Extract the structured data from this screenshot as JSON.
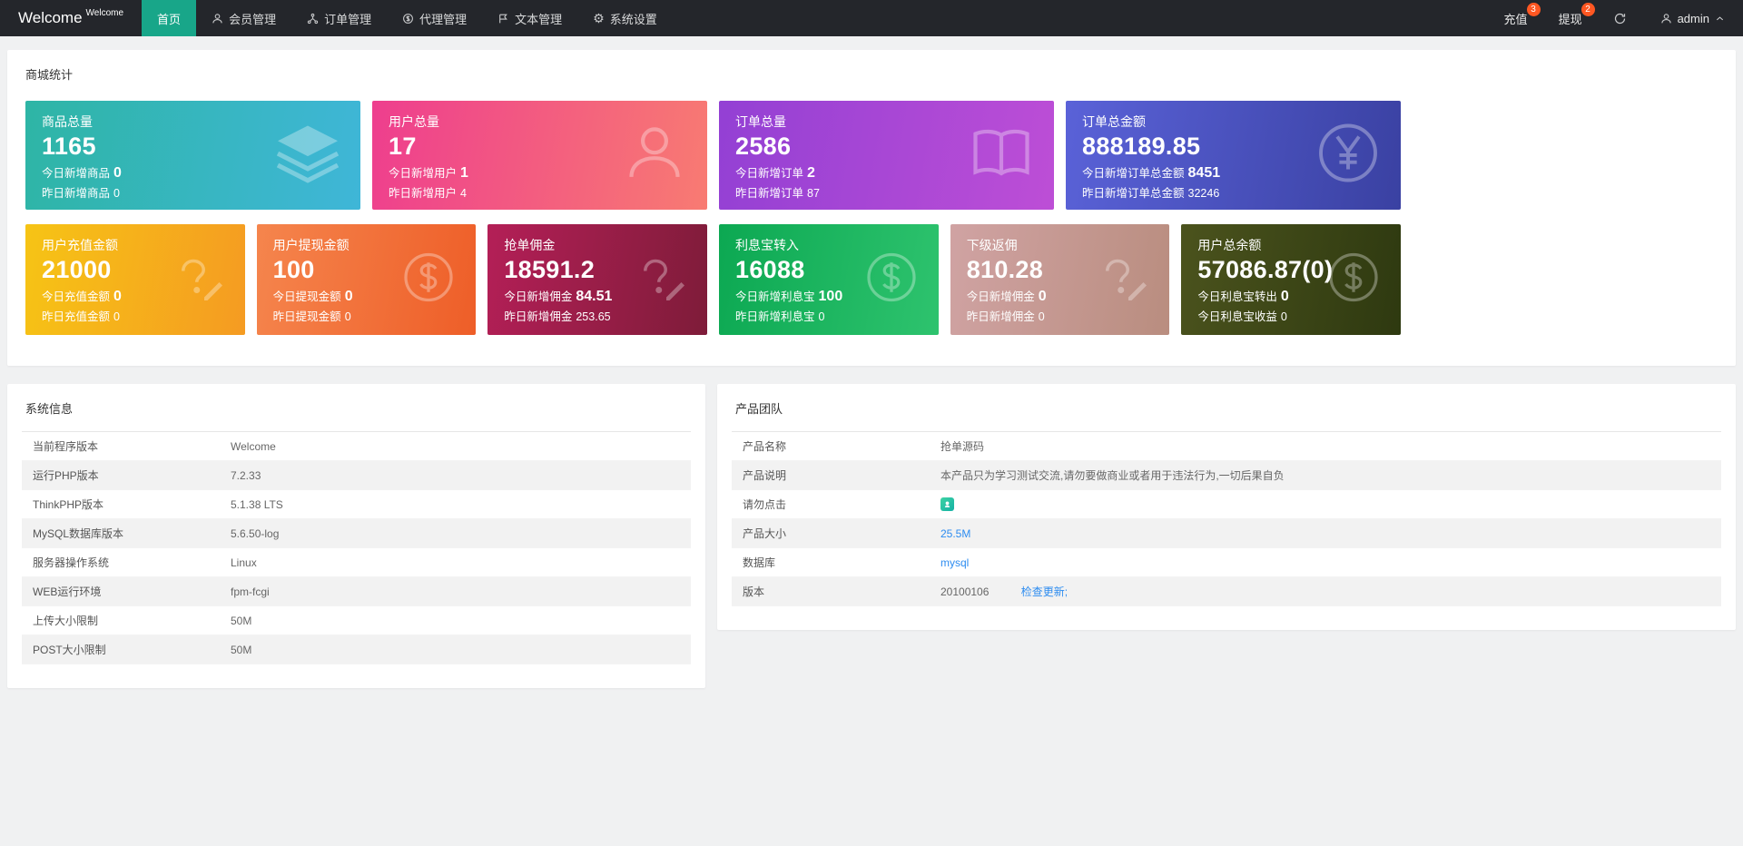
{
  "colors": {
    "navbar_bg": "#24262b",
    "accent_green": "#18a689",
    "badge_red": "#ff5722",
    "link_blue": "#2d8cf0",
    "page_bg": "#f0f1f2"
  },
  "navbar": {
    "logo": "Welcome",
    "logo_badge": "Welcome",
    "items": [
      {
        "label": "首页"
      },
      {
        "label": "会员管理"
      },
      {
        "label": "订单管理"
      },
      {
        "label": "代理管理"
      },
      {
        "label": "文本管理"
      },
      {
        "label": "系统设置"
      }
    ],
    "recharge_label": "充值",
    "recharge_badge": "3",
    "withdraw_label": "提现",
    "withdraw_badge": "2",
    "username": "admin"
  },
  "stats": {
    "title": "商城统计",
    "cards": [
      {
        "title": "商品总量",
        "value": "1165",
        "today_label": "今日新增商品",
        "today_value": "0",
        "yesterday_label": "昨日新增商品",
        "yesterday_value": "0",
        "icon": "layers-icon",
        "gradient": [
          "#2eb5a5",
          "#3fb6d8"
        ]
      },
      {
        "title": "用户总量",
        "value": "17",
        "today_label": "今日新增用户",
        "today_value": "1",
        "yesterday_label": "昨日新增用户",
        "yesterday_value": "4",
        "icon": "user-icon",
        "gradient": [
          "#ee3e8e",
          "#f87b72"
        ]
      },
      {
        "title": "订单总量",
        "value": "2586",
        "today_label": "今日新增订单",
        "today_value": "2",
        "yesterday_label": "昨日新增订单",
        "yesterday_value": "87",
        "icon": "book-icon",
        "gradient": [
          "#9340d4",
          "#bd4ed6"
        ]
      },
      {
        "title": "订单总金额",
        "value": "888189.85",
        "today_label": "今日新增订单总金额",
        "today_value": "8451",
        "yesterday_label": "昨日新增订单总金额",
        "yesterday_value": "32246",
        "icon": "yen-circle-icon",
        "gradient": [
          "#5a62d8",
          "#3a41a2"
        ]
      },
      {
        "title": "用户充值金额",
        "value": "21000",
        "today_label": "今日充值金额",
        "today_value": "0",
        "yesterday_label": "昨日充值金额",
        "yesterday_value": "0",
        "icon": "edit-icon",
        "gradient": [
          "#f6c415",
          "#f59b22"
        ]
      },
      {
        "title": "用户提现金额",
        "value": "100",
        "today_label": "今日提现金额",
        "today_value": "0",
        "yesterday_label": "昨日提现金额",
        "yesterday_value": "0",
        "icon": "dollar-circle-icon",
        "gradient": [
          "#f5854d",
          "#ee5e28"
        ]
      },
      {
        "title": "抢单佣金",
        "value": "18591.2",
        "today_label": "今日新增佣金",
        "today_value": "84.51",
        "yesterday_label": "昨日新增佣金",
        "yesterday_value": "253.65",
        "icon": "edit-icon",
        "gradient": [
          "#b41f57",
          "#7e1c39"
        ]
      },
      {
        "title": "利息宝转入",
        "value": "16088",
        "today_label": "今日新增利息宝",
        "today_value": "100",
        "yesterday_label": "昨日新增利息宝",
        "yesterday_value": "0",
        "icon": "dollar-circle-icon",
        "gradient": [
          "#0cа852",
          "#2ec36e"
        ]
      },
      {
        "title": "下级返佣",
        "value": "810.28",
        "today_label": "今日新增佣金",
        "today_value": "0",
        "yesterday_label": "昨日新增佣金",
        "yesterday_value": "0",
        "icon": "edit-icon",
        "gradient": [
          "#d0a3a3",
          "#b98d7f"
        ]
      },
      {
        "title": "用户总余额",
        "value": "57086.87(0)",
        "today_label": "今日利息宝转出",
        "today_value": "0",
        "yesterday_label": "今日利息宝收益",
        "yesterday_value": "0",
        "icon": "dollar-circle-icon",
        "gradient": [
          "#4b531d",
          "#2e3910"
        ]
      }
    ]
  },
  "system_info": {
    "title": "系统信息",
    "rows": [
      {
        "label": "当前程序版本",
        "value": "Welcome"
      },
      {
        "label": "运行PHP版本",
        "value": "7.2.33"
      },
      {
        "label": "ThinkPHP版本",
        "value": "5.1.38 LTS"
      },
      {
        "label": "MySQL数据库版本",
        "value": "5.6.50-log"
      },
      {
        "label": "服务器操作系统",
        "value": "Linux"
      },
      {
        "label": "WEB运行环境",
        "value": "fpm-fcgi"
      },
      {
        "label": "上传大小限制",
        "value": "50M"
      },
      {
        "label": "POST大小限制",
        "value": "50M"
      }
    ]
  },
  "product_team": {
    "title": "产品团队",
    "rows": [
      {
        "label": "产品名称",
        "value": "抢单源码"
      },
      {
        "label": "产品说明",
        "value": "本产品只为学习测试交流,请勿要做商业或者用于违法行为,一切后果自负"
      },
      {
        "label": "请勿点击",
        "value": ""
      },
      {
        "label": "产品大小",
        "value": "25.5M"
      },
      {
        "label": "数据库",
        "value": "mysql"
      },
      {
        "label": "版本",
        "value": "20100106",
        "extra": "检查更新;"
      }
    ]
  }
}
